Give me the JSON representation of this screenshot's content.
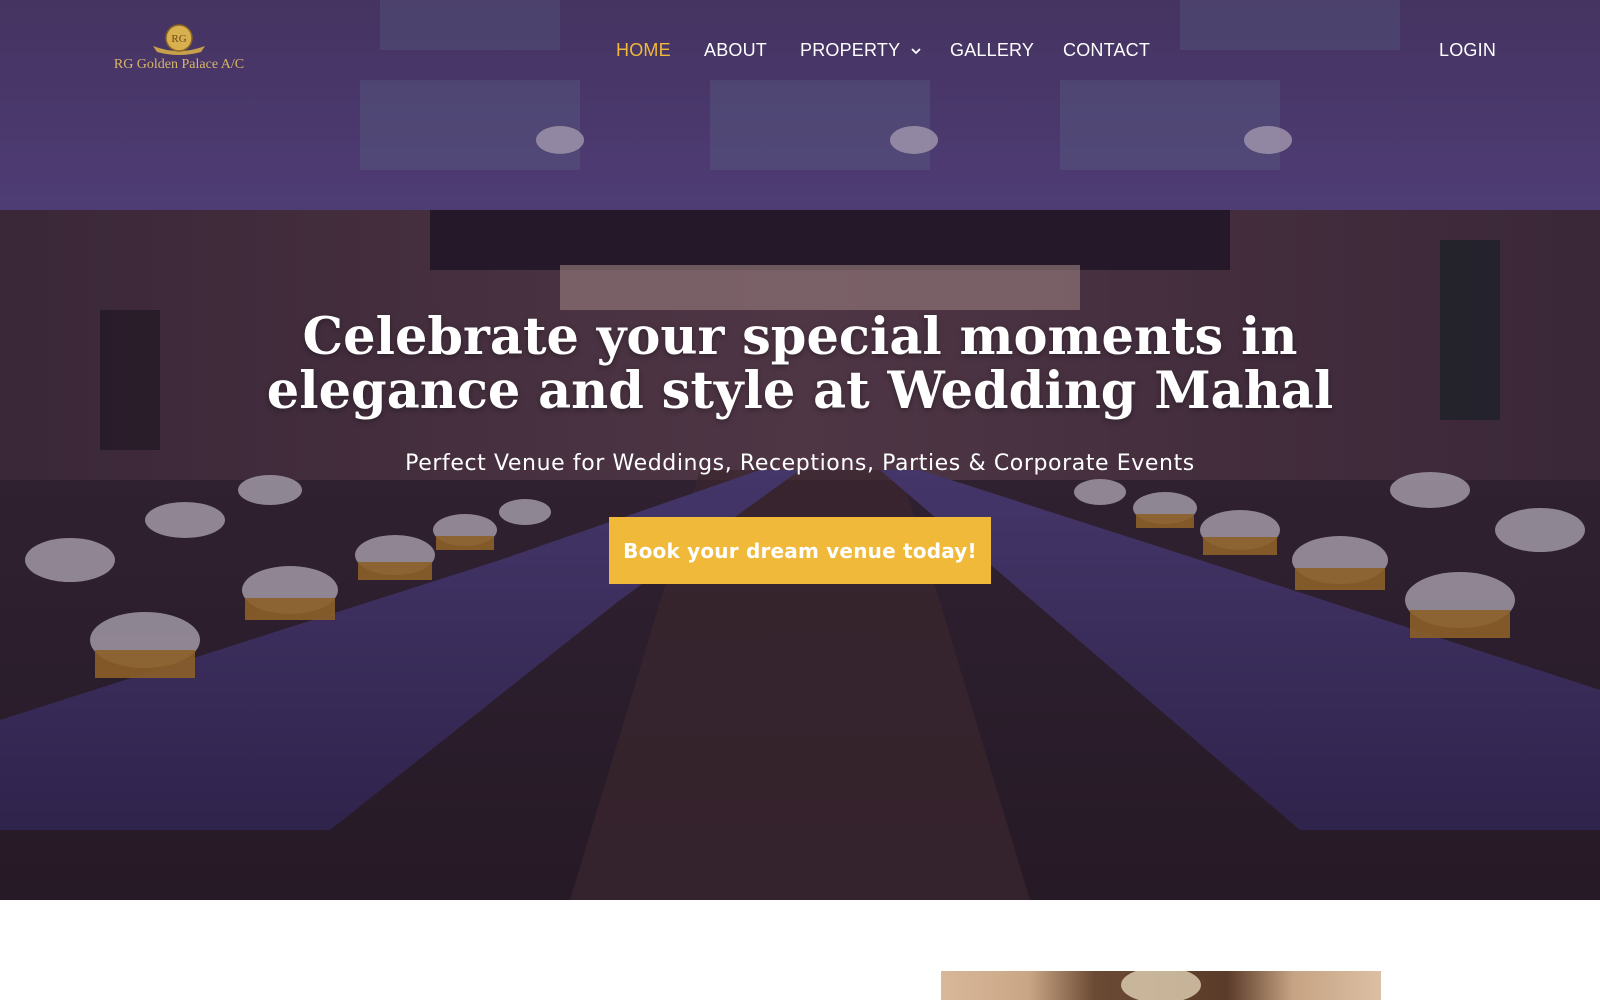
{
  "brand": {
    "name": "RG Golden Palace A/C",
    "emblem_letters": "RG",
    "gold": "#f0b93a"
  },
  "nav": {
    "items": [
      {
        "label": "HOME",
        "active": true
      },
      {
        "label": "ABOUT",
        "active": false
      },
      {
        "label": "PROPERTY",
        "active": false,
        "icon": "chevron-down-icon"
      },
      {
        "label": "GALLERY",
        "active": false
      },
      {
        "label": "CONTACT",
        "active": false
      }
    ],
    "login": "LOGIN"
  },
  "hero": {
    "headline": "Celebrate your special moments in elegance and style at Wedding Mahal",
    "subline": "Perfect Venue for Weddings, Receptions, Parties & Corporate Events",
    "cta": "Book your dream venue today!",
    "image": "banquet-hall-photo"
  }
}
